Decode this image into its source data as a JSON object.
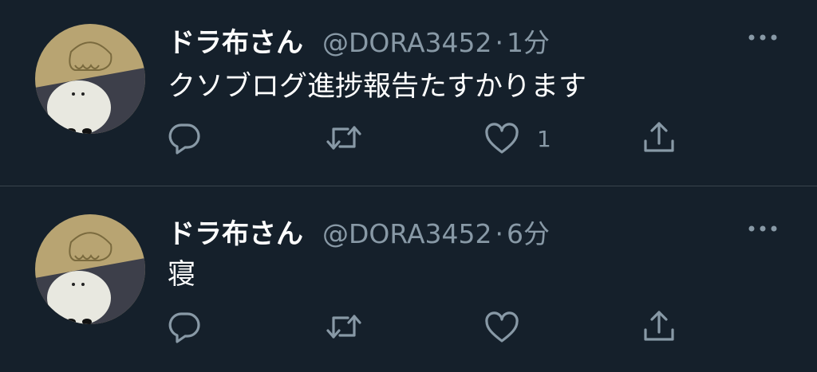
{
  "colors": {
    "background": "#15202b",
    "divider": "#38444d",
    "secondary_text": "#8899a6",
    "icon": "#8899a6"
  },
  "tweets": [
    {
      "display_name": "ドラ布さん",
      "handle": "@DORA3452",
      "separator": "·",
      "time": "1分",
      "text": "クソブログ進捗報告たすかります",
      "like_count": "1",
      "icons": [
        "reply-icon",
        "retweet-icon",
        "like-icon",
        "share-icon",
        "more-icon"
      ]
    },
    {
      "display_name": "ドラ布さん",
      "handle": "@DORA3452",
      "separator": "·",
      "time": "6分",
      "text": "寝",
      "like_count": "",
      "icons": [
        "reply-icon",
        "retweet-icon",
        "like-icon",
        "share-icon",
        "more-icon"
      ]
    }
  ]
}
